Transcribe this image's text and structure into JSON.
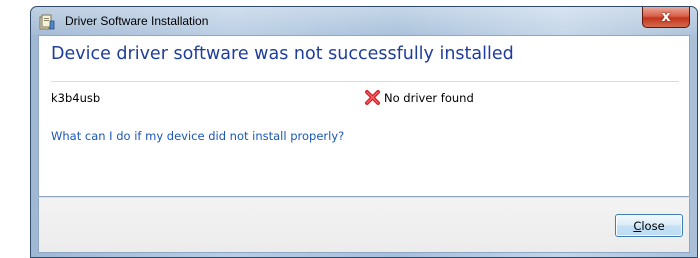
{
  "window": {
    "title": "Driver Software Installation",
    "title_icon": "driver-installation-icon",
    "close_glyph": "x"
  },
  "main": {
    "heading": "Device driver software was not successfully installed",
    "device": {
      "name": "k3b4usb",
      "status_icon": "red-x-error-icon",
      "status_text": "No driver found"
    },
    "help_link": "What can I do if my device did not install properly?"
  },
  "footer": {
    "close_button": {
      "accelerator": "C",
      "rest": "lose"
    }
  },
  "colors": {
    "heading": "#1f3d9a",
    "link": "#1a57b8",
    "error_icon": "#d8232a"
  }
}
